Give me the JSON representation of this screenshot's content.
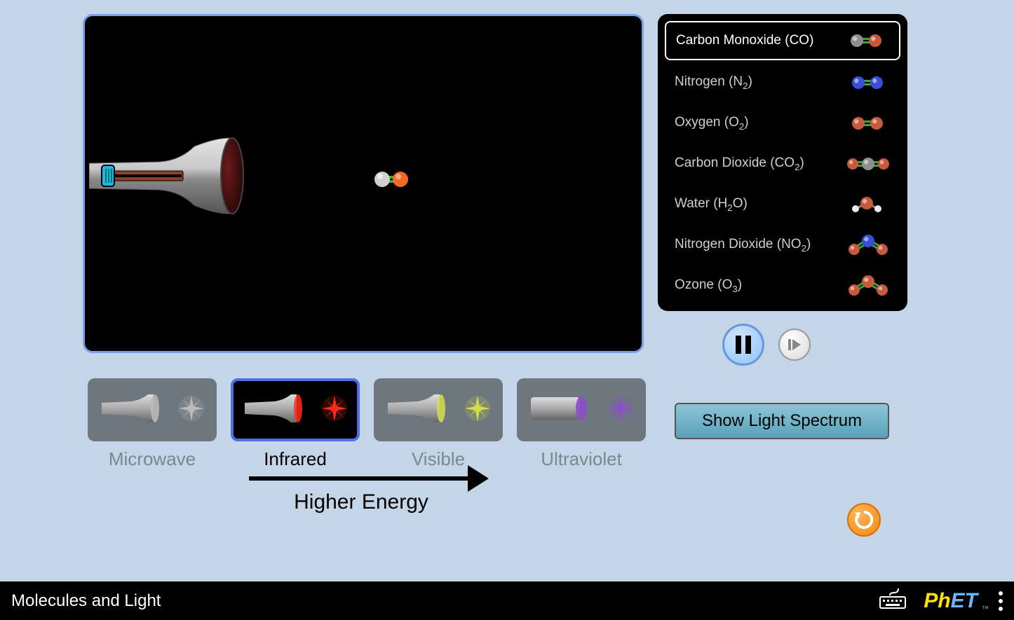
{
  "molecules": [
    {
      "label": "Carbon Monoxide (CO)",
      "html": "Carbon Monoxide (CO)",
      "type": "CO",
      "selected": true
    },
    {
      "label": "Nitrogen (N2)",
      "html": "Nitrogen (N<sub>2</sub>)",
      "type": "N2",
      "selected": false
    },
    {
      "label": "Oxygen (O2)",
      "html": "Oxygen (O<sub>2</sub>)",
      "type": "O2",
      "selected": false
    },
    {
      "label": "Carbon Dioxide (CO2)",
      "html": "Carbon Dioxide (CO<sub>2</sub>)",
      "type": "CO2",
      "selected": false
    },
    {
      "label": "Water (H2O)",
      "html": "Water (H<sub>2</sub>O)",
      "type": "H2O",
      "selected": false
    },
    {
      "label": "Nitrogen Dioxide (NO2)",
      "html": "Nitrogen Dioxide (NO<sub>2</sub>)",
      "type": "NO2",
      "selected": false
    },
    {
      "label": "Ozone (O3)",
      "html": "Ozone (O<sub>3</sub>)",
      "type": "O3",
      "selected": false
    }
  ],
  "lightSources": [
    {
      "label": "Microwave",
      "color": "#bbb",
      "selected": false
    },
    {
      "label": "Infrared",
      "color": "#ff2a1a",
      "selected": true
    },
    {
      "label": "Visible",
      "color": "#d5de4a",
      "selected": false
    },
    {
      "label": "Ultraviolet",
      "color": "#8b4fc8",
      "selected": false
    }
  ],
  "energyLabel": "Higher Energy",
  "spectrumBtn": "Show Light Spectrum",
  "simTitle": "Molecules and Light",
  "phet": {
    "p1": "Ph",
    "p2": "ET"
  }
}
